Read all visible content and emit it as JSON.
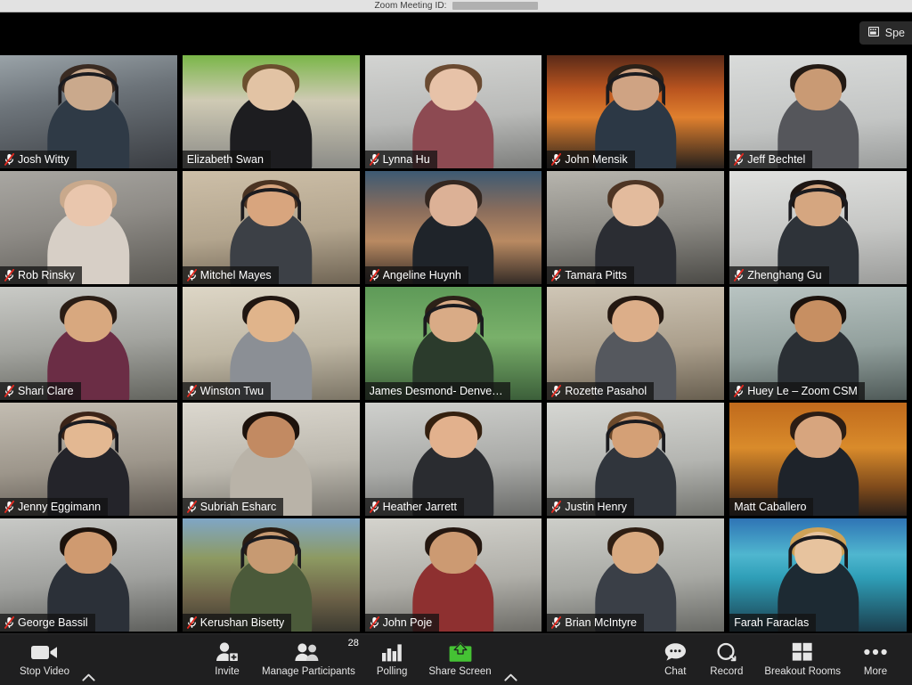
{
  "titlebar": {
    "meeting_id_label": "Zoom Meeting ID:",
    "meeting_id_value": ""
  },
  "topbar": {
    "view_toggle_label": "Spe",
    "view_toggle_full_label": "Speaker View",
    "view_toggle_icon": "window-grid-icon"
  },
  "grid": {
    "columns": 5,
    "rows": 5,
    "active_speaker": "Farah Faraclas",
    "active_border_color": "#d7e84a",
    "participants": [
      {
        "name": "Josh Witty",
        "muted": true,
        "bg": "office-desk"
      },
      {
        "name": "Elizabeth Swan",
        "muted": false,
        "bg": "green-wall"
      },
      {
        "name": "Lynna Hu",
        "muted": true,
        "bg": "cubicle-gray"
      },
      {
        "name": "John Mensik",
        "muted": true,
        "bg": "sunset-bridge"
      },
      {
        "name": "Jeff Bechtel",
        "muted": true,
        "bg": "office-white"
      },
      {
        "name": "Rob Rinsky",
        "muted": true,
        "bg": "baby-closeup"
      },
      {
        "name": "Mitchel Mayes",
        "muted": true,
        "bg": "cubicle-warm"
      },
      {
        "name": "Angeline Huynh",
        "muted": true,
        "bg": "beach-sunset"
      },
      {
        "name": "Tamara Pitts",
        "muted": true,
        "bg": "office-dark"
      },
      {
        "name": "Zhenghang Gu",
        "muted": true,
        "bg": "office-bright"
      },
      {
        "name": "Shari Clare",
        "muted": true,
        "bg": "office-board"
      },
      {
        "name": "Winston Twu",
        "muted": true,
        "bg": "office-pale"
      },
      {
        "name": "James Desmond- Denve…",
        "muted": false,
        "bg": "green-screen"
      },
      {
        "name": "Rozette Pasahol",
        "muted": true,
        "bg": "bookshelf"
      },
      {
        "name": "Huey Le – Zoom CSM",
        "muted": true,
        "bg": "office-teal"
      },
      {
        "name": "Jenny Eggimann",
        "muted": true,
        "bg": "office-desk2"
      },
      {
        "name": "Subriah Esharc",
        "muted": true,
        "bg": "office-light"
      },
      {
        "name": "Heather Jarrett",
        "muted": true,
        "bg": "office-neutral"
      },
      {
        "name": "Justin Henry",
        "muted": true,
        "bg": "office-cube"
      },
      {
        "name": "Matt Caballero",
        "muted": false,
        "bg": "autumn-trees"
      },
      {
        "name": "George Bassil",
        "muted": true,
        "bg": "office-hall"
      },
      {
        "name": "Kerushan Bisetty",
        "muted": true,
        "bg": "backyard-fence"
      },
      {
        "name": "John Poje",
        "muted": true,
        "bg": "office-room"
      },
      {
        "name": "Brian McIntyre",
        "muted": true,
        "bg": "office-two"
      },
      {
        "name": "Farah Faraclas",
        "muted": false,
        "bg": "lake-mountains"
      }
    ]
  },
  "toolbar": {
    "left": [
      {
        "label": "Stop Video",
        "icon": "video-camera-icon",
        "has_caret": true,
        "count": null
      }
    ],
    "middle": [
      {
        "label": "Invite",
        "icon": "invite-person-icon",
        "has_caret": false,
        "count": null
      },
      {
        "label": "Manage Participants",
        "icon": "participants-icon",
        "has_caret": false,
        "count": "28"
      },
      {
        "label": "Polling",
        "icon": "bar-chart-icon",
        "has_caret": false,
        "count": null
      },
      {
        "label": "Share Screen",
        "icon": "share-screen-icon",
        "has_caret": true,
        "count": null
      }
    ],
    "right": [
      {
        "label": "Chat",
        "icon": "chat-bubble-icon",
        "has_caret": false,
        "count": null
      },
      {
        "label": "Record",
        "icon": "record-circle-icon",
        "has_caret": false,
        "count": null
      },
      {
        "label": "Breakout Rooms",
        "icon": "grid-squares-icon",
        "has_caret": false,
        "count": null
      },
      {
        "label": "More",
        "icon": "more-dots-icon",
        "has_caret": false,
        "count": null
      }
    ],
    "share_accent_color": "#45c234"
  }
}
